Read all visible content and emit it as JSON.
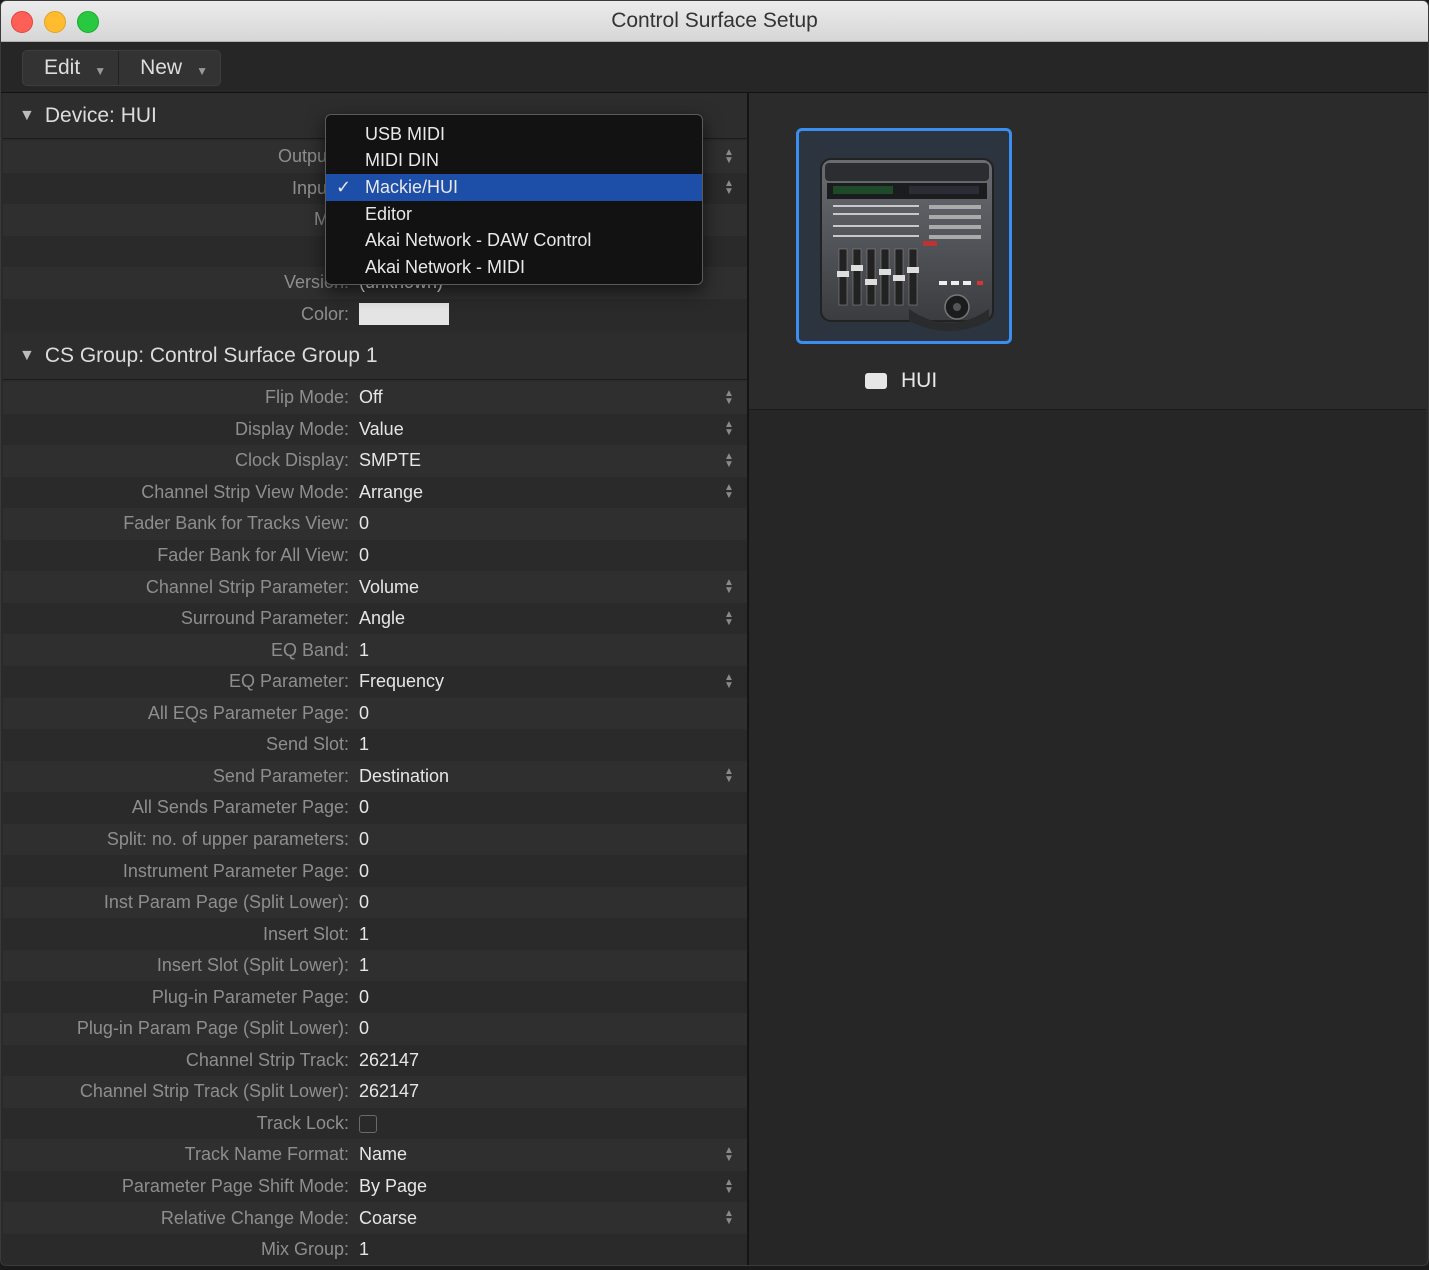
{
  "window": {
    "title": "Control Surface Setup"
  },
  "toolbar": {
    "edit_label": "Edit",
    "new_label": "New"
  },
  "device_section": {
    "title": "Device:  HUI",
    "rows": [
      {
        "label": "Output P",
        "value": ""
      },
      {
        "label": "Input P",
        "value": ""
      },
      {
        "label": "Mod",
        "value": ""
      },
      {
        "label": "Mo",
        "value": ""
      },
      {
        "label": "Version:",
        "value": "(unknown)"
      },
      {
        "label": "Color:",
        "value": ""
      }
    ],
    "color_value": "#e4e4e4"
  },
  "port_menu": {
    "items": [
      "USB MIDI",
      "MIDI DIN",
      "Mackie/HUI",
      "Editor",
      "Akai Network - DAW Control",
      "Akai Network - MIDI"
    ],
    "selected_index": 2
  },
  "cs_group": {
    "title": "CS Group:  Control Surface Group 1",
    "rows": [
      {
        "label": "Flip Mode:",
        "value": "Off",
        "popup": true
      },
      {
        "label": "Display Mode:",
        "value": "Value",
        "popup": true
      },
      {
        "label": "Clock Display:",
        "value": "SMPTE",
        "popup": true
      },
      {
        "label": "Channel Strip View Mode:",
        "value": "Arrange",
        "popup": true
      },
      {
        "label": "Fader Bank for Tracks View:",
        "value": "0",
        "popup": false
      },
      {
        "label": "Fader Bank for All View:",
        "value": "0",
        "popup": false
      },
      {
        "label": "Channel Strip Parameter:",
        "value": "Volume",
        "popup": true
      },
      {
        "label": "Surround Parameter:",
        "value": "Angle",
        "popup": true
      },
      {
        "label": "EQ Band:",
        "value": "1",
        "popup": false
      },
      {
        "label": "EQ Parameter:",
        "value": "Frequency",
        "popup": true
      },
      {
        "label": "All EQs Parameter Page:",
        "value": "0",
        "popup": false
      },
      {
        "label": "Send Slot:",
        "value": "1",
        "popup": false
      },
      {
        "label": "Send Parameter:",
        "value": "Destination",
        "popup": true
      },
      {
        "label": "All Sends Parameter Page:",
        "value": "0",
        "popup": false
      },
      {
        "label": "Split: no. of upper parameters:",
        "value": "0",
        "popup": false
      },
      {
        "label": "Instrument Parameter Page:",
        "value": "0",
        "popup": false
      },
      {
        "label": "Inst Param Page (Split Lower):",
        "value": "0",
        "popup": false
      },
      {
        "label": "Insert Slot:",
        "value": "1",
        "popup": false
      },
      {
        "label": "Insert Slot (Split Lower):",
        "value": "1",
        "popup": false
      },
      {
        "label": "Plug-in Parameter Page:",
        "value": "0",
        "popup": false
      },
      {
        "label": "Plug-in Param Page (Split Lower):",
        "value": "0",
        "popup": false
      },
      {
        "label": "Channel Strip Track:",
        "value": "262147",
        "popup": false
      },
      {
        "label": "Channel Strip Track (Split Lower):",
        "value": "262147",
        "popup": false
      },
      {
        "label": "Track Lock:",
        "value": "",
        "checkbox": true,
        "checked": false
      },
      {
        "label": "Track Name Format:",
        "value": "Name",
        "popup": true
      },
      {
        "label": "Parameter Page Shift Mode:",
        "value": "By Page",
        "popup": true
      },
      {
        "label": "Relative Change Mode:",
        "value": "Coarse",
        "popup": true
      },
      {
        "label": "Mix Group:",
        "value": "1",
        "popup": false
      }
    ]
  },
  "device_tile": {
    "label": "HUI",
    "icon": "control-surface-device-icon",
    "selected": true,
    "accent": "#3b8ef0"
  }
}
